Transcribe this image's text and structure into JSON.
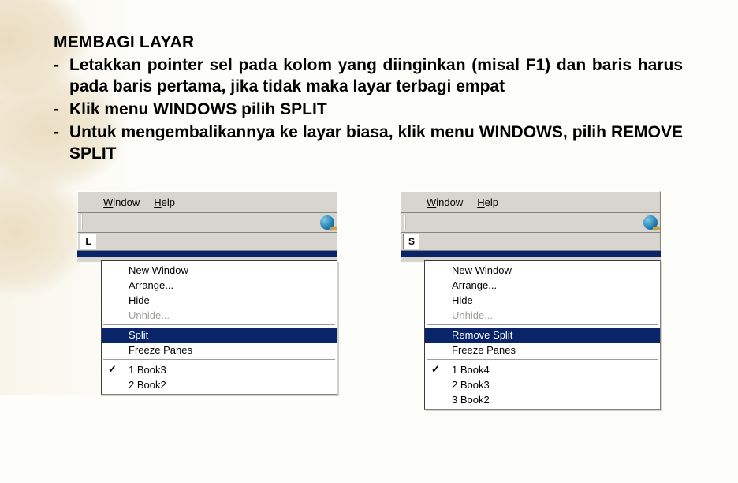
{
  "title": "MEMBAGI LAYAR",
  "bullets": [
    "Letakkan pointer sel pada kolom yang diinginkan (misal F1) dan baris harus pada baris pertama, jika tidak maka layar terbagi empat",
    "Klik menu WINDOWS pilih SPLIT",
    "Untuk mengembalikannya ke layar biasa, klik menu WINDOWS, pilih REMOVE SPLIT"
  ],
  "menuLeft": {
    "menubar": {
      "window": "Window",
      "help": "Help"
    },
    "nameboxLetter": "L",
    "items": {
      "newWindow": "New Window",
      "arrange": "Arrange...",
      "hide": "Hide",
      "unhide": "Unhide...",
      "split": "Split",
      "freeze": "Freeze Panes",
      "book1": "1 Book3",
      "book2": "2 Book2"
    }
  },
  "menuRight": {
    "menubar": {
      "window": "Window",
      "help": "Help"
    },
    "nameboxLetter": "S",
    "items": {
      "newWindow": "New Window",
      "arrange": "Arrange...",
      "hide": "Hide",
      "unhide": "Unhide...",
      "removeSplit": "Remove Split",
      "freeze": "Freeze Panes",
      "book1": "1 Book4",
      "book2": "2 Book3",
      "book3": "3 Book2"
    }
  }
}
